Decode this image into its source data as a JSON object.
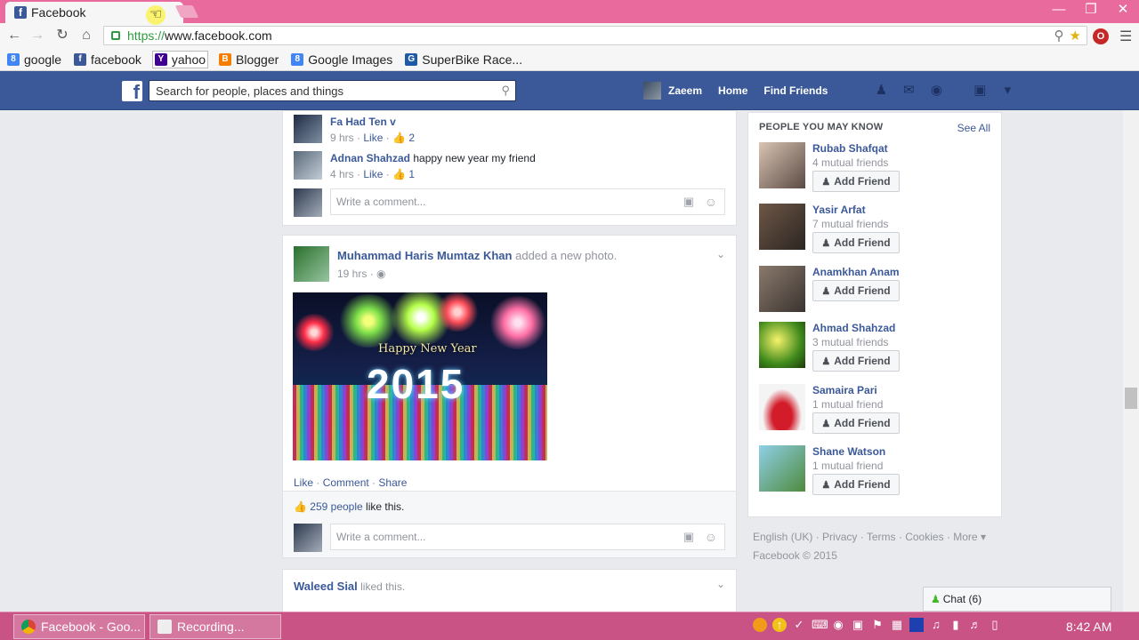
{
  "browser": {
    "tab_title": "Facebook",
    "url_scheme": "https://",
    "url_rest": "www.facebook.com",
    "bookmarks": [
      {
        "label": "google",
        "icon": "google-icon",
        "color": "#4285f4"
      },
      {
        "label": "facebook",
        "icon": "facebook-icon",
        "color": "#3b5998"
      },
      {
        "label": "yahoo",
        "icon": "yahoo-icon",
        "color": "#400090"
      },
      {
        "label": "Blogger",
        "icon": "blogger-icon",
        "color": "#f57d00"
      },
      {
        "label": "Google Images",
        "icon": "google-icon",
        "color": "#4285f4"
      },
      {
        "label": "SuperBike Race...",
        "icon": "game-icon",
        "color": "#1e5aa8"
      }
    ]
  },
  "fb_header": {
    "search_placeholder": "Search for people, places and things",
    "user_name": "Zaeem",
    "home": "Home",
    "find_friends": "Find Friends"
  },
  "feed": {
    "comments": [
      {
        "author": "Fa Had Ten v",
        "text": "",
        "time": "9 hrs",
        "like": "Like",
        "likes": "2"
      },
      {
        "author": "Adnan Shahzad",
        "text": "happy new year my friend",
        "time": "4 hrs",
        "like": "Like",
        "likes": "1"
      }
    ],
    "comment_placeholder": "Write a comment...",
    "post": {
      "author": "Muhammad Haris Mumtaz Khan",
      "action": "added a new photo.",
      "time": "19 hrs",
      "photo_caption": "Happy New Year",
      "photo_year": "2015",
      "actions": [
        "Like",
        "Comment",
        "Share"
      ],
      "likes_count": "259 people",
      "likes_suffix": "like this."
    },
    "next_story": {
      "author": "Waleed Sial",
      "action": "liked this."
    }
  },
  "pymk": {
    "title": "PEOPLE YOU MAY KNOW",
    "see_all": "See All",
    "add_label": "Add Friend",
    "people": [
      {
        "name": "Rubab Shafqat",
        "mutual": "4 mutual friends"
      },
      {
        "name": "Yasir Arfat",
        "mutual": "7 mutual friends"
      },
      {
        "name": "Anamkhan Anam",
        "mutual": ""
      },
      {
        "name": "Ahmad Shahzad",
        "mutual": "3 mutual friends"
      },
      {
        "name": "Samaira Pari",
        "mutual": "1 mutual friend"
      },
      {
        "name": "Shane Watson",
        "mutual": "1 mutual friend"
      }
    ]
  },
  "footer": {
    "links": [
      "English (UK)",
      "Privacy",
      "Terms",
      "Cookies",
      "More"
    ],
    "copyright": "Facebook © 2015"
  },
  "chat": {
    "label": "Chat (6)"
  },
  "taskbar": {
    "items": [
      "Facebook - Goo...",
      "Recording..."
    ],
    "clock": "8:42 AM"
  },
  "colors": {
    "facebook_blue": "#3b5998",
    "taskbar": "#c95384",
    "titlebar": "#e96a9c"
  }
}
